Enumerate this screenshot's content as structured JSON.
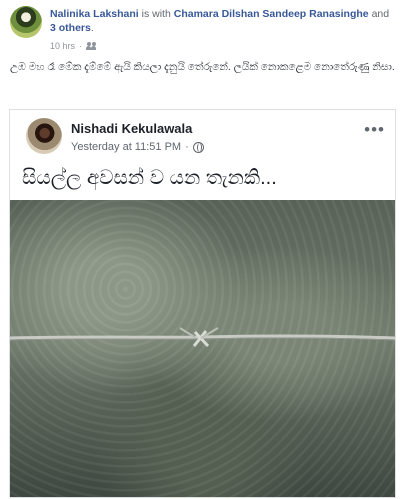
{
  "post": {
    "author": "Nalinika Lakshani",
    "with_text": "is with",
    "with_people": "Chamara Dilshan Sandeep Ranasinghe",
    "and_text": "and",
    "others_text": "3 others",
    "time": "10 hrs",
    "privacy_icon": "friends-icon",
    "text": "උඹ මහ රෑ මේක දැම්මේ ඇයි කියලා දැනුයි තේරුනේ. ලයික් නොකළෙම නොතේරුණු නිසා."
  },
  "shared": {
    "author": "Nishadi Kekulawala",
    "time": "Yesterday at 11:51 PM",
    "privacy_icon": "globe-icon",
    "more_icon": "more-options-icon",
    "text": "සියල්ල අවසන් ව යන තැනකි..."
  }
}
